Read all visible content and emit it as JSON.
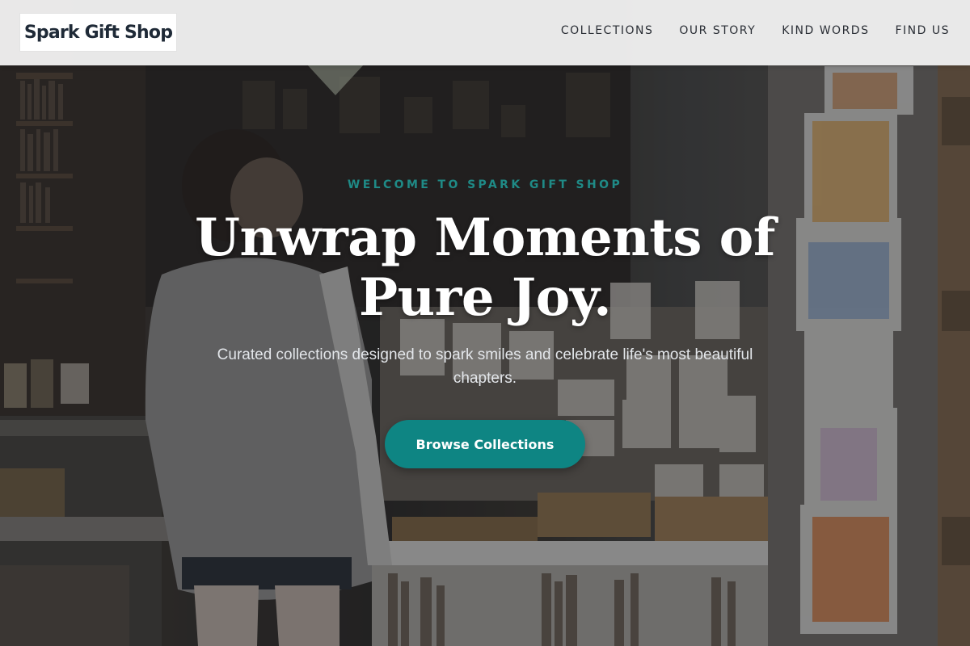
{
  "brand": {
    "name": "Spark Gift Shop"
  },
  "nav": {
    "items": [
      {
        "label": "COLLECTIONS"
      },
      {
        "label": "OUR STORY"
      },
      {
        "label": "KIND WORDS"
      },
      {
        "label": "FIND US"
      }
    ]
  },
  "hero": {
    "eyebrow": "WELCOME TO SPARK GIFT SHOP",
    "headline": "Unwrap Moments of Pure Joy.",
    "subtitle": "Curated collections designed to spark smiles and celebrate life's most beautiful chapters.",
    "cta_label": "Browse Collections"
  },
  "colors": {
    "accent": "#0e8583",
    "eyebrow": "#1f8a86",
    "header_bg": "#f0f0f0",
    "text_dark": "#1f2a37"
  }
}
